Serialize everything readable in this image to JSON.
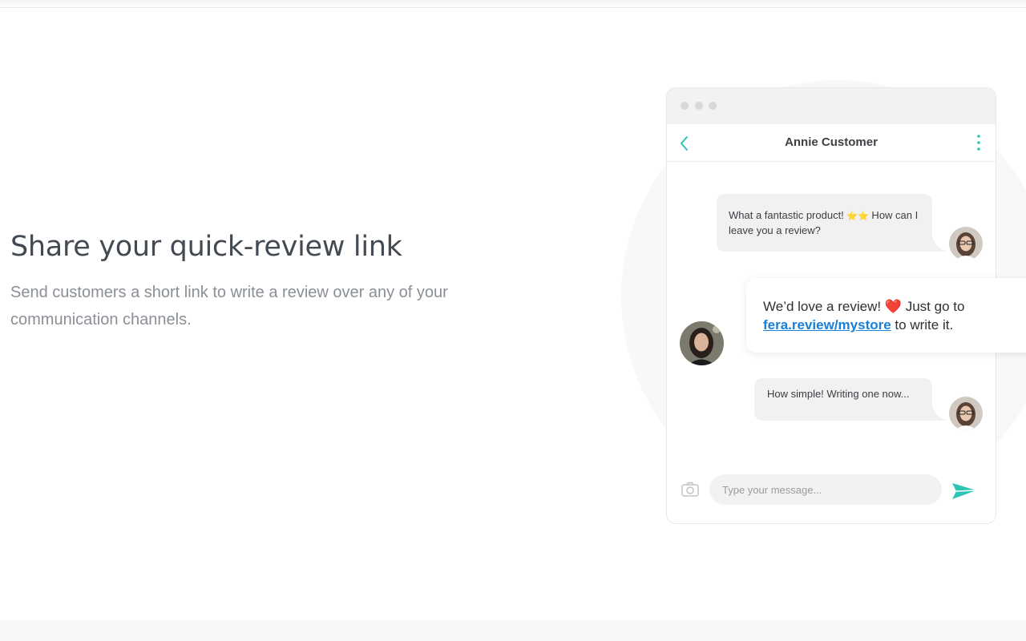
{
  "hero": {
    "headline": "Share your quick-review link",
    "subtext": "Send customers a short link to write a review over any of your communication channels."
  },
  "chat": {
    "contact_name": "Annie Customer",
    "messages": [
      {
        "text_before": "What a fantastic product! ",
        "emoji": "⭐⭐",
        "text_after": " How can I leave you a review?"
      },
      {
        "text_before": "We’d love a review! ",
        "emoji": "❤️",
        "text_mid": "  Just go to ",
        "link": "fera.review/mystore",
        "text_after": " to write it."
      },
      {
        "text": "How simple! Writing one now..."
      }
    ],
    "composer_placeholder": "Type your message..."
  },
  "colors": {
    "accent": "#2ec4b6",
    "link": "#1a7fd8",
    "heart": "#e0242a"
  },
  "icons": [
    "back-chevron-icon",
    "more-vertical-icon",
    "camera-icon",
    "send-icon"
  ]
}
